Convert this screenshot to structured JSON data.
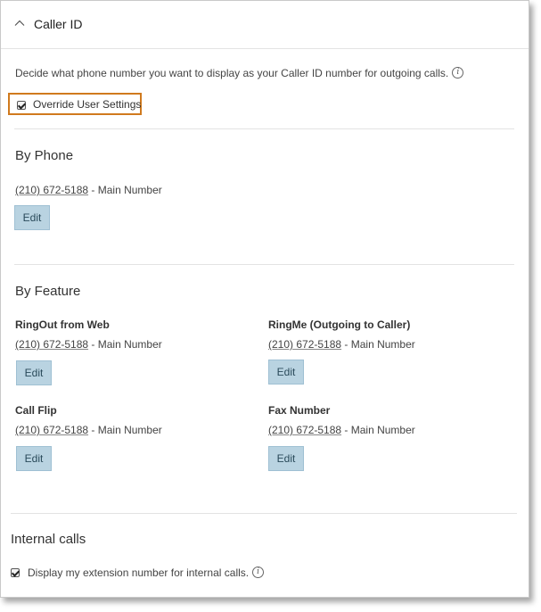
{
  "header": {
    "title": "Caller ID"
  },
  "description": "Decide what phone number you want to display as your Caller ID number for outgoing calls.",
  "override": {
    "label": "Override User Settings",
    "checked": true
  },
  "by_phone": {
    "title": "By Phone",
    "number": "(210) 672-5188",
    "suffix": " - Main Number",
    "edit_label": "Edit"
  },
  "by_feature": {
    "title": "By Feature",
    "items": [
      {
        "name": "RingOut from Web",
        "number": "(210) 672-5188",
        "suffix": " - Main Number",
        "edit_label": "Edit"
      },
      {
        "name": "RingMe (Outgoing to Caller)",
        "number": "(210) 672-5188",
        "suffix": " - Main Number",
        "edit_label": "Edit"
      },
      {
        "name": "Call Flip",
        "number": "(210) 672-5188",
        "suffix": " - Main Number",
        "edit_label": "Edit"
      },
      {
        "name": "Fax Number",
        "number": "(210) 672-5188",
        "suffix": " - Main Number",
        "edit_label": "Edit"
      }
    ]
  },
  "internal": {
    "title": "Internal calls",
    "label": "Display my extension number for internal calls.",
    "checked": true
  },
  "colors": {
    "highlight": "#d07a1e",
    "button_bg": "#b9d3e1"
  },
  "icons": {
    "collapse": "chevron-up-icon",
    "info": "info-icon",
    "check": "checkmark-icon"
  }
}
